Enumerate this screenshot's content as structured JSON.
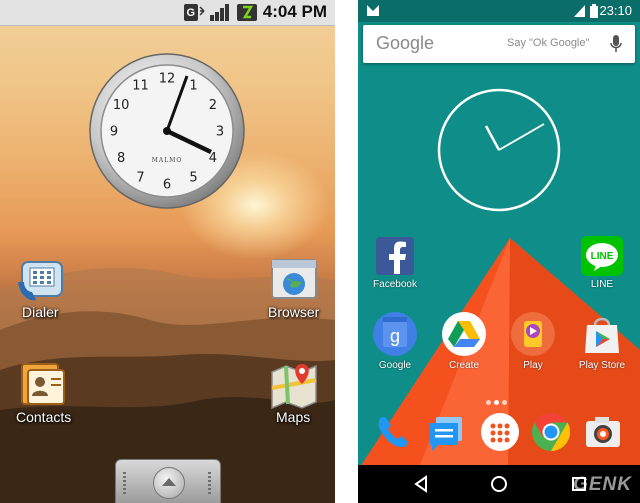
{
  "left_screen": {
    "status_time": "4:04 PM",
    "clock_brand": "MALMO",
    "clock_numbers": [
      "12",
      "1",
      "2",
      "3",
      "4",
      "5",
      "6",
      "7",
      "8",
      "9",
      "10",
      "11"
    ],
    "apps": [
      {
        "label": "Dialer",
        "icon": "dialer-icon"
      },
      {
        "label": "Browser",
        "icon": "browser-icon"
      },
      {
        "label": "Contacts",
        "icon": "contacts-icon"
      },
      {
        "label": "Maps",
        "icon": "maps-icon"
      }
    ]
  },
  "right_screen": {
    "status_time": "23:10",
    "search": {
      "logo": "Google",
      "hint": "Say \"Ok Google\""
    },
    "apps_row1": [
      {
        "label": "Facebook",
        "icon": "facebook-icon",
        "color": "#3b5998"
      },
      {
        "label": "LINE",
        "icon": "line-icon",
        "color": "#00c300"
      }
    ],
    "apps_row2": [
      {
        "label": "Google",
        "icon": "google-icon",
        "color": "#3f7fe6"
      },
      {
        "label": "Create",
        "icon": "drive-icon",
        "color": "#fbbc05"
      },
      {
        "label": "Play",
        "icon": "play-games-icon",
        "color": "#e64a19"
      },
      {
        "label": "Play Store",
        "icon": "play-store-icon",
        "color": "#8bc34a"
      }
    ],
    "dock": [
      "phone-icon",
      "messaging-icon",
      "app-drawer-icon",
      "chrome-icon",
      "camera-icon"
    ],
    "watermark": "GENK"
  }
}
